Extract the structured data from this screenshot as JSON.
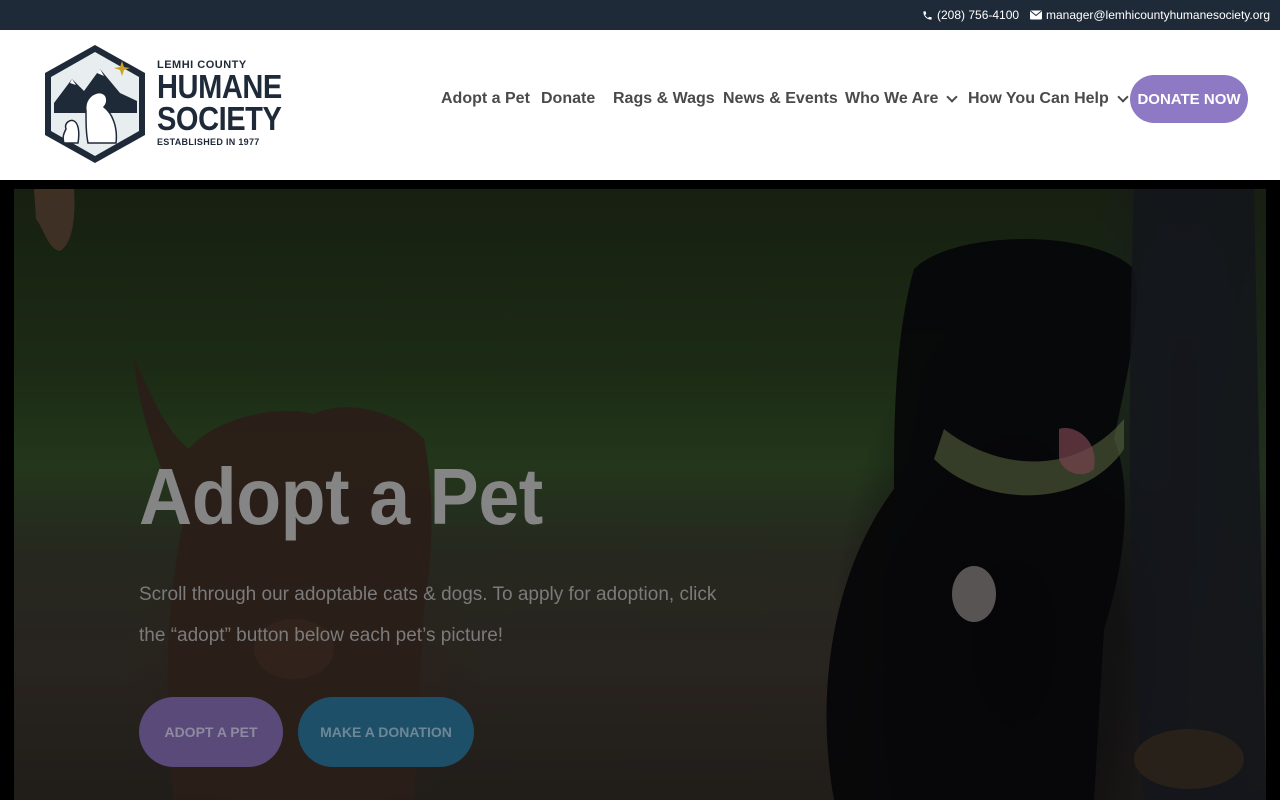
{
  "topbar": {
    "phone": "(208) 756-4100",
    "email": "manager@lemhicountyhumanesociety.org",
    "phone_icon": "phone-icon",
    "email_icon": "envelope-icon"
  },
  "logo": {
    "line1": "LEMHI COUNTY",
    "line2": "HUMANE",
    "line3": "SOCIETY",
    "line4": "ESTABLISHED IN 1977"
  },
  "nav": {
    "items": [
      {
        "label": "Adopt a Pet"
      },
      {
        "label": "Donate"
      },
      {
        "label": "Rags & Wags"
      },
      {
        "label": "News & Events"
      },
      {
        "label": "Who We Are"
      },
      {
        "label": "How You Can Help"
      }
    ],
    "cta": "DONATE NOW"
  },
  "hero": {
    "title": "Adopt a Pet",
    "text": "Scroll through our adoptable cats & dogs. To apply for adoption, click the “adopt” button below each pet’s picture!",
    "button_adopt": "ADOPT A PET",
    "button_donation": "MAKE A DONATION"
  },
  "colors": {
    "topbar": "#1f2a39",
    "accent_purple": "#8e79c5",
    "accent_teal": "#1e4f68"
  }
}
